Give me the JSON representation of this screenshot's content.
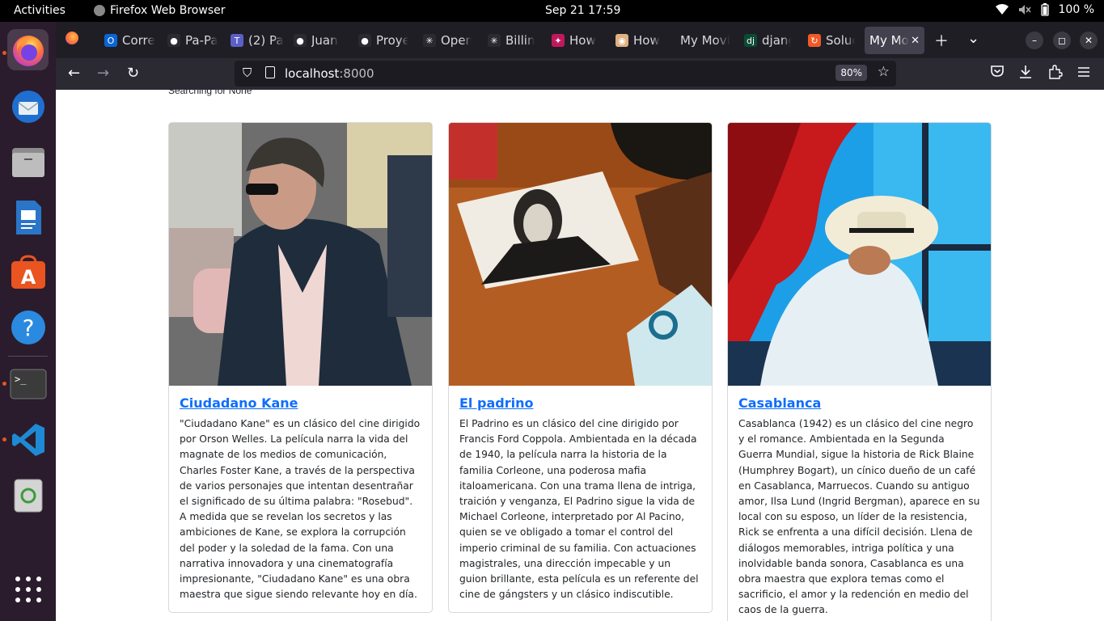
{
  "topbar": {
    "activities": "Activities",
    "app_name": "Firefox Web Browser",
    "clock": "Sep 21  17:59",
    "battery": "100 %"
  },
  "dock": {
    "items": [
      "firefox-icon",
      "thunderbird-icon",
      "files-icon",
      "writer-icon",
      "app-center-icon",
      "help-icon",
      "terminal-icon",
      "vscode-icon",
      "trash-icon",
      "app-grid-icon"
    ]
  },
  "browser": {
    "tabs": [
      {
        "label": "Corre",
        "icon": "outlook-icon",
        "color": "#0a64d6"
      },
      {
        "label": "Pa-Pa",
        "icon": "github-icon",
        "color": "#2b2a33"
      },
      {
        "label": "(2) Pa",
        "icon": "teams-icon",
        "color": "#5b5fc7"
      },
      {
        "label": "Juan",
        "icon": "github-icon",
        "color": "#2b2a33"
      },
      {
        "label": "Proye",
        "icon": "github-icon",
        "color": "#2b2a33"
      },
      {
        "label": "Open",
        "icon": "openai-icon",
        "color": "#2b2a33"
      },
      {
        "label": "Billin",
        "icon": "openai-icon",
        "color": "#2b2a33"
      },
      {
        "label": "How",
        "icon": "pinwheel-icon",
        "color": "#c2185b"
      },
      {
        "label": "How",
        "icon": "avatar-icon",
        "color": "#e0b080"
      },
      {
        "label": "My Movi",
        "icon": "",
        "color": "#1f1e25"
      },
      {
        "label": "djang",
        "icon": "django-icon",
        "color": "#0c4b33"
      },
      {
        "label": "Soluc",
        "icon": "refresh-orange-icon",
        "color": "#f05a28"
      },
      {
        "label": "My Mo",
        "icon": "",
        "color": "#42414d"
      }
    ],
    "url_host": "localhost",
    "url_port": ":8000",
    "zoom": "80%"
  },
  "page": {
    "searching": "Searching for None",
    "movies": [
      {
        "title": "Ciudadano Kane",
        "description": "\"Ciudadano Kane\" es un clásico del cine dirigido por Orson Welles. La película narra la vida del magnate de los medios de comunicación, Charles Foster Kane, a través de la perspectiva de varios personajes que intentan desentrañar el significado de su última palabra: \"Rosebud\". A medida que se revelan los secretos y las ambiciones de Kane, se explora la corrupción del poder y la soledad de la fama. Con una narrativa innovadora y una cinematografía impresionante, \"Ciudadano Kane\" es una obra maestra que sigue siendo relevante hoy en día."
      },
      {
        "title": "El padrino",
        "description": "El Padrino es un clásico del cine dirigido por Francis Ford Coppola. Ambientada en la década de 1940, la película narra la historia de la familia Corleone, una poderosa mafia italoamericana. Con una trama llena de intriga, traición y venganza, El Padrino sigue la vida de Michael Corleone, interpretado por Al Pacino, quien se ve obligado a tomar el control del imperio criminal de su familia. Con actuaciones magistrales, una dirección impecable y un guion brillante, esta película es un referente del cine de gángsters y un clásico indiscutible."
      },
      {
        "title": "Casablanca",
        "description": "Casablanca (1942) es un clásico del cine negro y el romance. Ambientada en la Segunda Guerra Mundial, sigue la historia de Rick Blaine (Humphrey Bogart), un cínico dueño de un café en Casablanca, Marruecos. Cuando su antiguo amor, Ilsa Lund (Ingrid Bergman), aparece en su local con su esposo, un líder de la resistencia, Rick se enfrenta a una difícil decisión. Llena de diálogos memorables, intriga política y una inolvidable banda sonora, Casablanca es una obra maestra que explora temas como el sacrificio, el amor y la redención en medio del caos de la guerra."
      }
    ]
  }
}
